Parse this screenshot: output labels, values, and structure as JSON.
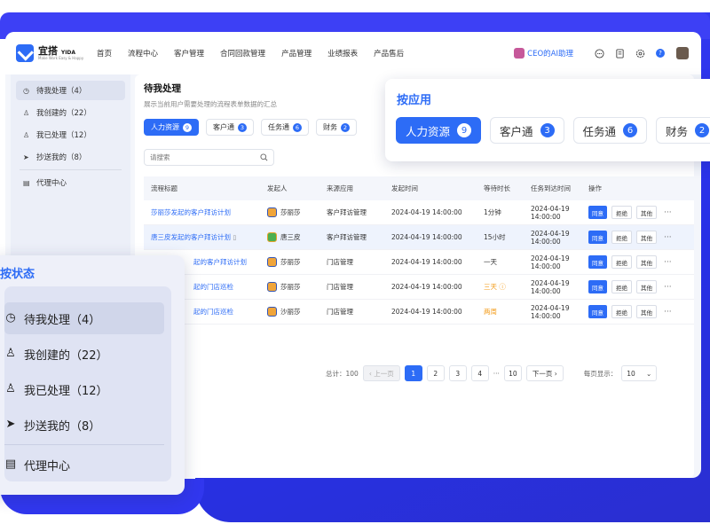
{
  "colors": {
    "accent": "#2d6cf6",
    "warning": "#f39b18",
    "background_blue": "#3b3ef7"
  },
  "app": {
    "logo_name": "宜搭",
    "logo_sub": "YIDA",
    "logo_tagline": "Make Work Easy & Happy"
  },
  "nav": [
    "首页",
    "流程中心",
    "客户管理",
    "合同回款管理",
    "产品管理",
    "业绩报表",
    "产品售后"
  ],
  "header_right": {
    "ai_assistant": "CEO的AI助理",
    "icons": [
      "chat-icon",
      "document-icon",
      "settings-icon",
      "help-icon",
      "user-avatar"
    ]
  },
  "sidebar": {
    "items": [
      {
        "icon": "clock-icon",
        "label": "待我处理（4）",
        "active": true
      },
      {
        "icon": "user-create-icon",
        "label": "我创建的（22）"
      },
      {
        "icon": "user-check-icon",
        "label": "我已处理（12）"
      },
      {
        "icon": "send-icon",
        "label": "抄送我的（8）"
      }
    ],
    "agent": {
      "icon": "agent-icon",
      "label": "代理中心"
    }
  },
  "page": {
    "title": "待我处理",
    "subtitle": "展示当前用户需要处理的流程表单数据的汇总",
    "filters": [
      {
        "label": "人力资源",
        "count": "9",
        "active": true
      },
      {
        "label": "客户通",
        "count": "3"
      },
      {
        "label": "任务通",
        "count": "6"
      },
      {
        "label": "财务",
        "count": "2"
      }
    ],
    "search_placeholder": "请搜索"
  },
  "table": {
    "columns": [
      "流程标题",
      "发起人",
      "来源应用",
      "发起时间",
      "等待时长",
      "任务到达时间",
      "操作"
    ],
    "rows": [
      {
        "title": "莎丽莎发起的客户拜访计划",
        "initiator": "莎丽莎",
        "app": "客户拜访管理",
        "start": "2024-04-19 14:00:00",
        "wait": "1分钟",
        "arrive": "2024-04-19 14:00:00",
        "highlight": false
      },
      {
        "title": "唐三皮发起的客户拜访计划",
        "initiator": "唐三皮",
        "app": "客户拜访管理",
        "start": "2024-04-19 14:00:00",
        "wait": "15小时",
        "arrive": "2024-04-19 14:00:00",
        "highlight": true
      },
      {
        "title": "起的客户拜访计划",
        "initiator": "莎丽莎",
        "app": "门店管理",
        "start": "2024-04-19 14:00:00",
        "wait": "一天",
        "arrive": "2024-04-19 14:00:00",
        "highlight": false
      },
      {
        "title": "起的门店巡检",
        "initiator": "莎丽莎",
        "app": "门店管理",
        "start": "2024-04-19 14:00:00",
        "wait": "三天",
        "arrive": "2024-04-19 14:00:00",
        "highlight": false
      },
      {
        "title": "起的门店巡检",
        "initiator": "沙丽莎",
        "app": "门店管理",
        "start": "2024-04-19 14:00:00",
        "wait": "两周",
        "arrive": "2024-04-19 14:00:00",
        "highlight": false
      }
    ],
    "actions": {
      "agree": "同意",
      "reject": "拒绝",
      "other": "其他",
      "more": "···"
    }
  },
  "pagination": {
    "total": "总计：100",
    "prev": "上一页",
    "pages": [
      "1",
      "2",
      "3",
      "4"
    ],
    "ellipsis": "···",
    "last": "10",
    "next": "下一页",
    "per_page_label": "每页显示：",
    "per_page_value": "10"
  },
  "app_card": {
    "title": "按应用",
    "tabs": [
      {
        "label": "人力资源",
        "count": "9",
        "active": true
      },
      {
        "label": "客户通",
        "count": "3"
      },
      {
        "label": "任务通",
        "count": "6"
      },
      {
        "label": "财务",
        "count": "2"
      }
    ]
  },
  "status_card": {
    "title": "按状态",
    "items": [
      {
        "icon": "clock-icon",
        "label": "待我处理（4）",
        "active": true
      },
      {
        "icon": "user-create-icon",
        "label": "我创建的（22）"
      },
      {
        "icon": "user-check-icon",
        "label": "我已处理（12）"
      },
      {
        "icon": "send-icon",
        "label": "抄送我的（8）"
      }
    ],
    "agent": {
      "icon": "agent-icon",
      "label": "代理中心"
    }
  }
}
